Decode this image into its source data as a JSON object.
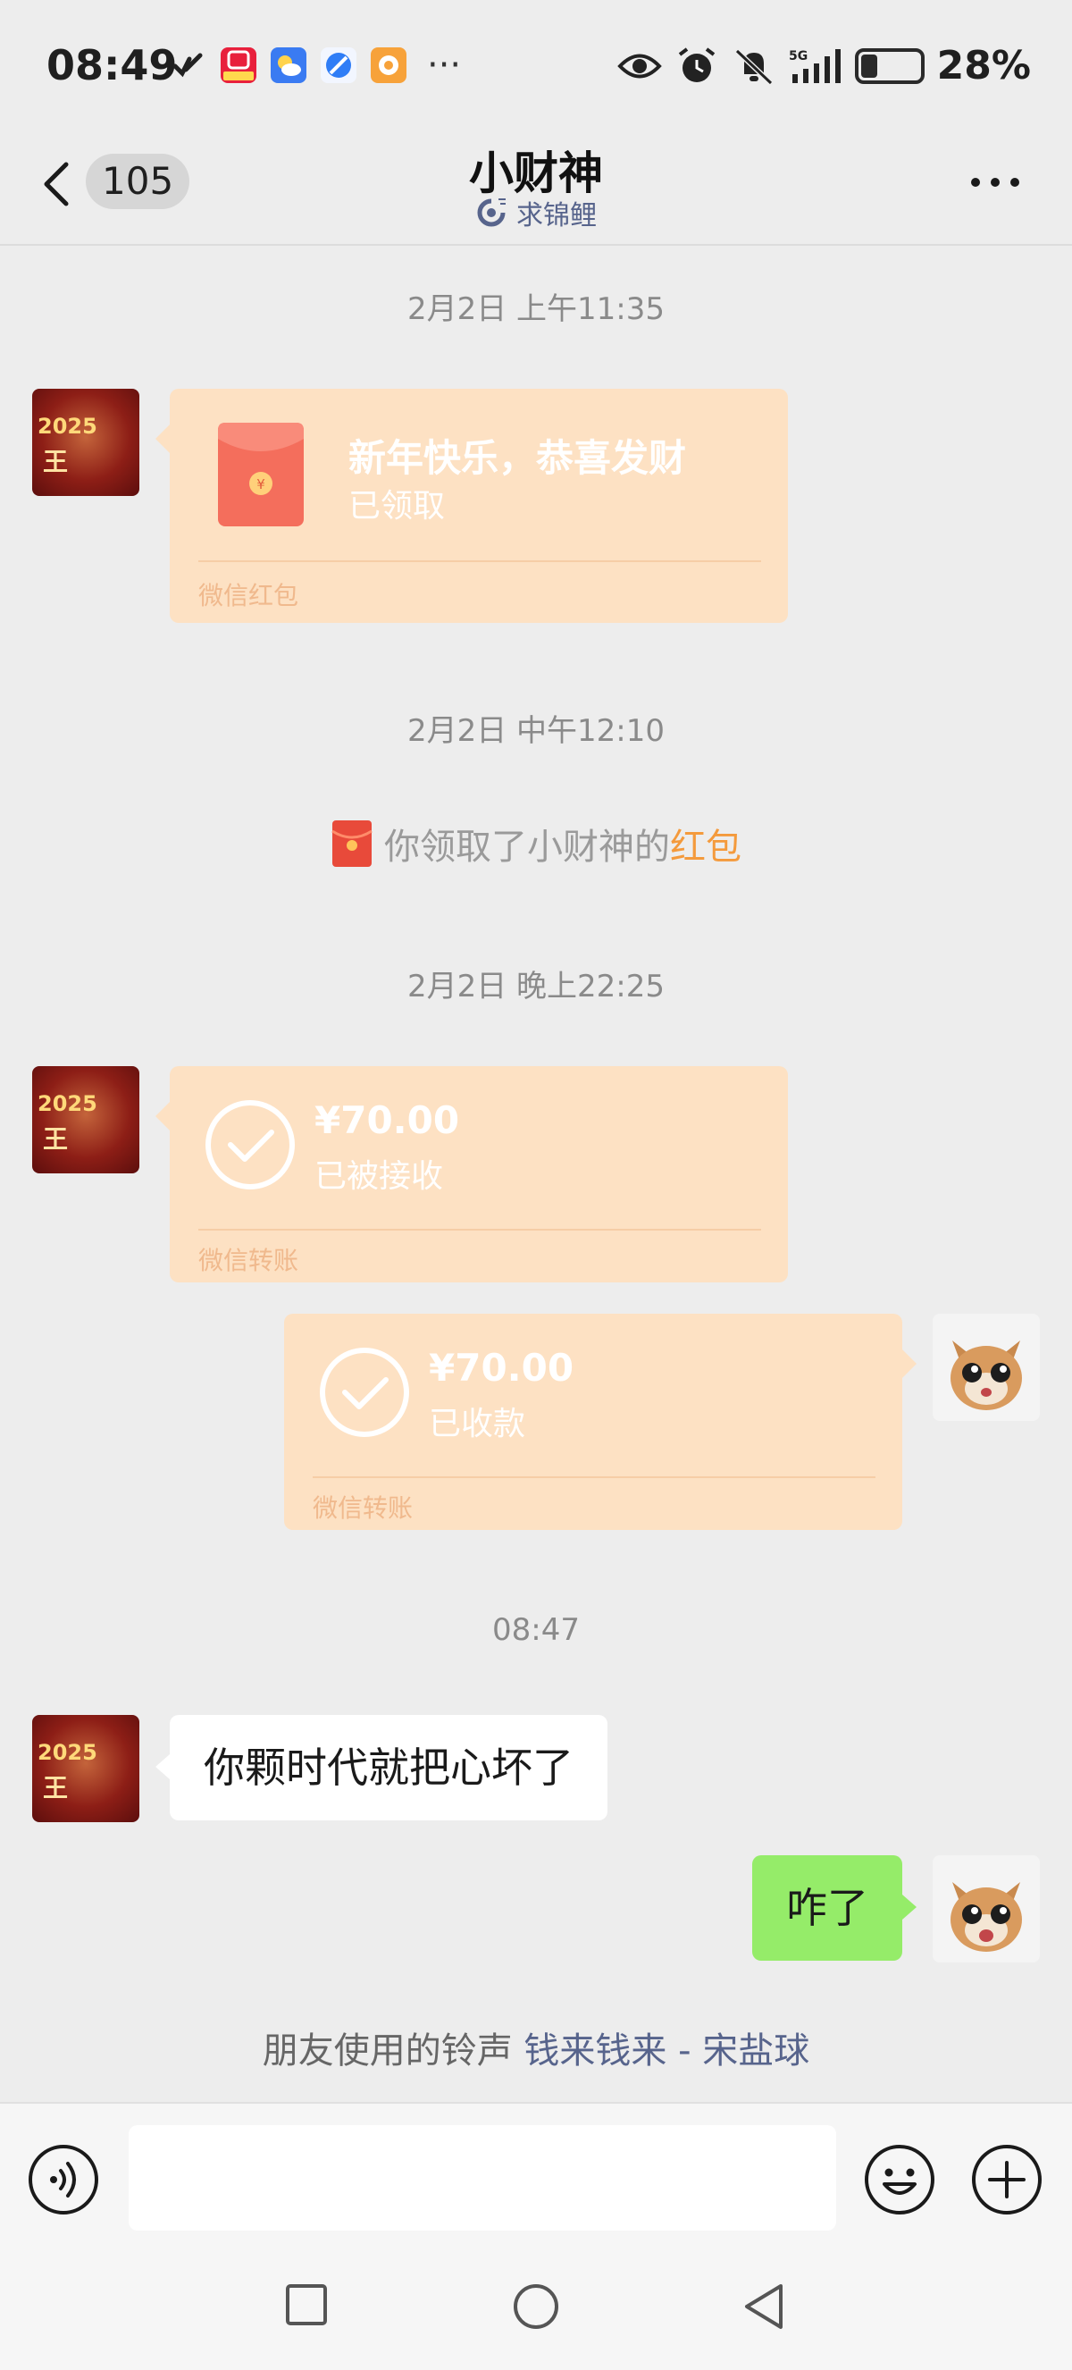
{
  "status_bar": {
    "time": "08:49",
    "battery_percent": "28%",
    "battery_level": 0.28,
    "network": "5G",
    "app_icons": [
      "vpn-icon",
      "red-envelope-app-icon",
      "weather-app-icon",
      "browser-app-icon",
      "photos-app-icon"
    ],
    "more_label": "···"
  },
  "nav": {
    "unread_count": "105",
    "title": "小财神",
    "subtitle": "求锦鲤"
  },
  "messages": {
    "ts1": "2月2日 上午11:35",
    "red_packet": {
      "title": "新年快乐，恭喜发财",
      "status": "已领取",
      "footer": "微信红包"
    },
    "ts2": "2月2日 中午12:10",
    "notice": {
      "prefix": "你领取了小财神的",
      "link": "红包"
    },
    "ts3": "2月2日 晚上22:25",
    "transfer_in": {
      "amount": "¥70.00",
      "status": "已被接收",
      "footer": "微信转账"
    },
    "transfer_out": {
      "amount": "¥70.00",
      "status": "已收款",
      "footer": "微信转账"
    },
    "ts4": "08:47",
    "text_in": "你颗时代就把心坏了",
    "text_out": "咋了",
    "avatar_year": "2025",
    "avatar_char": "王"
  },
  "ringtone": {
    "prefix": "朋友使用的铃声 ",
    "song": "钱来钱来 - 宋盐球"
  },
  "input": {
    "placeholder": ""
  },
  "colors": {
    "background": "#ededed",
    "card": "#fde1c3",
    "green_bubble": "#95ec69",
    "link_blue": "#57648c",
    "notice_orange": "#f49a3c"
  }
}
